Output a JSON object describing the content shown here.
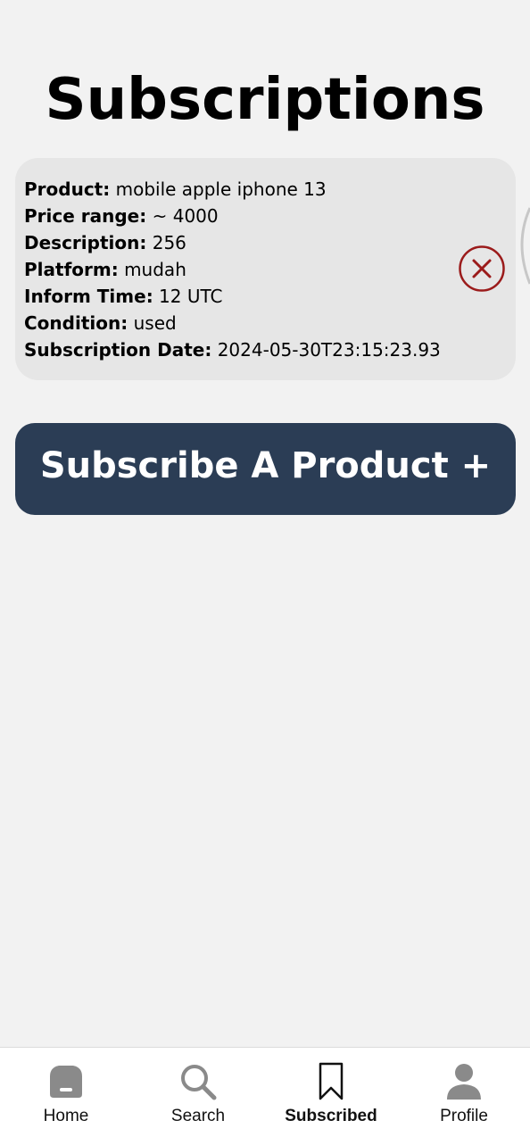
{
  "page": {
    "title": "Subscriptions"
  },
  "subscription": {
    "fields": [
      {
        "label": "Product:",
        "value": "mobile apple iphone 13"
      },
      {
        "label": "Price range:",
        "value": " ~ 4000"
      },
      {
        "label": "Description:",
        "value": "256"
      },
      {
        "label": "Platform:",
        "value": "mudah"
      },
      {
        "label": "Inform Time:",
        "value": "12 UTC"
      },
      {
        "label": "Condition:",
        "value": "used"
      },
      {
        "label": "Subscription Date:",
        "value": "2024-05-30T23:15:23.93"
      }
    ],
    "remove_icon": "close-circle-icon"
  },
  "subscribe_button": {
    "label": "Subscribe A Product +"
  },
  "nav": {
    "items": [
      {
        "label": "Home",
        "icon": "home-icon"
      },
      {
        "label": "Search",
        "icon": "search-icon"
      },
      {
        "label": "Subscribed",
        "icon": "bookmark-icon"
      },
      {
        "label": "Profile",
        "icon": "profile-icon"
      }
    ],
    "active": "Subscribed"
  },
  "colors": {
    "background": "#f2f2f2",
    "card": "#e6e6e6",
    "button": "#2b3d55",
    "remove": "#9b1b1b",
    "nav_icon": "#8a8a8a"
  }
}
